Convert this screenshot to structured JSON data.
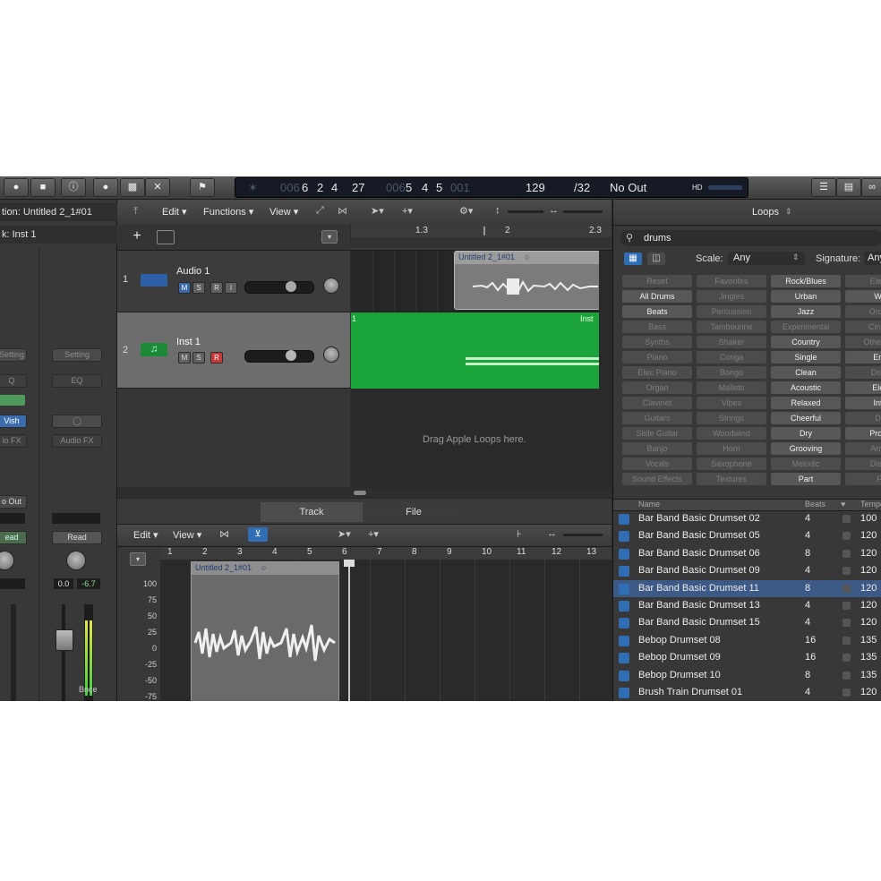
{
  "transport": {
    "bars_dim": "006",
    "bar": "6",
    "beat": "2",
    "div": "4",
    "tick": "27",
    "end_dim": "006",
    "end_bar": "5",
    "end_beat": "4",
    "end_div": "5",
    "end_tick": "001",
    "tempo": "129",
    "signature": "/32",
    "input": "No Out",
    "hd": "HD"
  },
  "inspector": {
    "region_label": "tion: Untitled 2_1#01",
    "track_label": "k: Inst 1",
    "setting_1": "Setting",
    "setting_2": "Setting",
    "eq_1": "Q",
    "eq_2": "EQ",
    "link_1": "Vish",
    "fx_1": "lo FX",
    "fx_2": "Audio FX",
    "out_label": "o Out",
    "read_1": "ead",
    "read_2": "Read",
    "vol_1": "0.0",
    "vol_2": "-6.7",
    "bnce": "Bnce",
    "scale": [
      "100",
      "75",
      "50",
      "25",
      "0",
      "-25",
      "-50",
      "-75"
    ]
  },
  "tracks_toolbar": {
    "edit": "Edit",
    "functions": "Functions",
    "view": "View"
  },
  "ruler": {
    "marks": [
      "1.3",
      "2",
      "2.3"
    ]
  },
  "tracks": [
    {
      "number": "1",
      "name": "Audio 1",
      "m": "M",
      "s": "S",
      "r": "R",
      "i": "I"
    },
    {
      "number": "2",
      "name": "Inst 1",
      "m": "M",
      "s": "S",
      "r": "R"
    }
  ],
  "regions": {
    "audio_name": "Untitled 2_1#01",
    "inst_name": "Inst",
    "inst_marker": "1",
    "drop_hint": "Drag Apple Loops here."
  },
  "editor": {
    "tab_track": "Track",
    "tab_file": "File",
    "edit": "Edit",
    "view": "View",
    "region_name": "Untitled 2_1#01",
    "bars": [
      "1",
      "2",
      "3",
      "4",
      "5",
      "6",
      "7",
      "8",
      "9",
      "10",
      "11",
      "12",
      "13"
    ],
    "scale": [
      "100",
      "75",
      "50",
      "25",
      "0",
      "-25",
      "-50",
      "-75"
    ]
  },
  "loops": {
    "title": "Loops",
    "search": "drums",
    "scale_label": "Scale:",
    "scale_value": "Any",
    "signature_label": "Signature:",
    "signature_value": "Any",
    "col1": [
      "Reset",
      "All Drums",
      "Beats",
      "Bass",
      "Synths",
      "Piano",
      "Elec Piano",
      "Organ",
      "Clavinet",
      "Guitars",
      "Slide Guitar",
      "Banjo",
      "Vocals",
      "Sound Effects"
    ],
    "col2": [
      "Favorites",
      "Jingles",
      "Percussion",
      "Tambourine",
      "Shaker",
      "Conga",
      "Bongo",
      "Mallets",
      "Vibes",
      "Strings",
      "Woodwind",
      "Horn",
      "Saxophone",
      "Textures"
    ],
    "col3": [
      "Rock/Blues",
      "Urban",
      "Jazz",
      "Experimental",
      "Country",
      "Single",
      "Clean",
      "Acoustic",
      "Relaxed",
      "Cheerful",
      "Dry",
      "Grooving",
      "Melodic",
      "Part"
    ],
    "col4": [
      "Electr",
      "Wo",
      "Orche",
      "Cinem",
      "Other Ge",
      "Ens",
      "Disto",
      "Elec",
      "Inte",
      "Da",
      "Proce",
      "Arrhy",
      "Disso",
      "Fi"
    ],
    "col1_on": [
      false,
      true,
      true,
      false,
      false,
      false,
      false,
      false,
      false,
      false,
      false,
      false,
      false,
      false
    ],
    "col2_on": [
      false,
      false,
      false,
      false,
      false,
      false,
      false,
      false,
      false,
      false,
      false,
      false,
      false,
      false
    ],
    "col3_on": [
      true,
      true,
      true,
      false,
      true,
      true,
      true,
      true,
      true,
      true,
      true,
      true,
      false,
      true
    ],
    "col4_on": [
      false,
      true,
      false,
      false,
      false,
      true,
      false,
      true,
      true,
      false,
      true,
      false,
      false,
      false
    ],
    "header_name": "Name",
    "header_beats": "Beats",
    "header_tempo": "Tempo",
    "results": [
      {
        "name": "Bar Band Basic Drumset 02",
        "beats": "4",
        "tempo": "100"
      },
      {
        "name": "Bar Band Basic Drumset 05",
        "beats": "4",
        "tempo": "120"
      },
      {
        "name": "Bar Band Basic Drumset 06",
        "beats": "8",
        "tempo": "120"
      },
      {
        "name": "Bar Band Basic Drumset 09",
        "beats": "4",
        "tempo": "120"
      },
      {
        "name": "Bar Band Basic Drumset 11",
        "beats": "8",
        "tempo": "120"
      },
      {
        "name": "Bar Band Basic Drumset 13",
        "beats": "4",
        "tempo": "120"
      },
      {
        "name": "Bar Band Basic Drumset 15",
        "beats": "4",
        "tempo": "120"
      },
      {
        "name": "Bebop Drumset 08",
        "beats": "16",
        "tempo": "135"
      },
      {
        "name": "Bebop Drumset 09",
        "beats": "16",
        "tempo": "135"
      },
      {
        "name": "Bebop Drumset 10",
        "beats": "8",
        "tempo": "135"
      },
      {
        "name": "Brush Train Drumset 01",
        "beats": "4",
        "tempo": "120"
      }
    ],
    "selected_index": 4
  },
  "colors": {
    "green_region": "#1aa43a",
    "selection_blue": "#3d5a86",
    "record_red": "#c83a3a"
  }
}
